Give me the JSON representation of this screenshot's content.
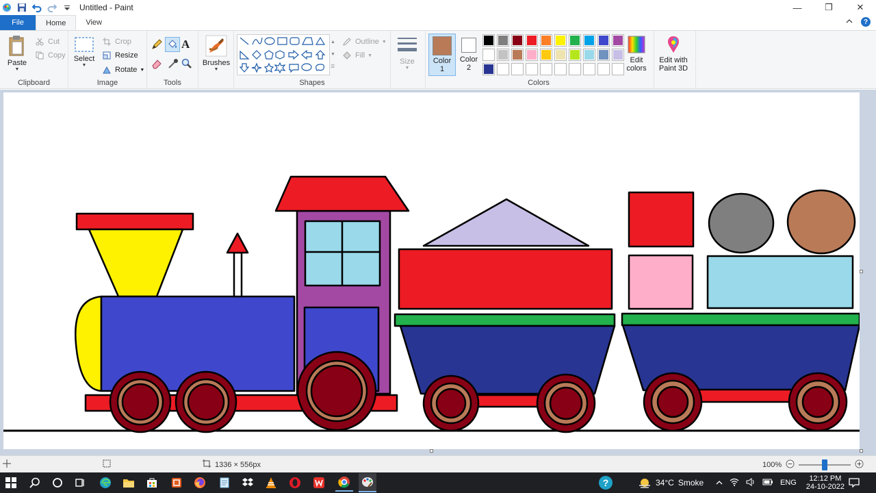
{
  "window": {
    "title": "Untitled - Paint",
    "controls": {
      "minimize": "—",
      "maximize": "❐",
      "close": "✕"
    }
  },
  "ribbon_tabs": [
    {
      "label": "File"
    },
    {
      "label": "Home"
    },
    {
      "label": "View"
    }
  ],
  "clipboard": {
    "paste_label": "Paste",
    "cut_label": "Cut",
    "copy_label": "Copy",
    "group_label": "Clipboard"
  },
  "image": {
    "select_label": "Select",
    "crop_label": "Crop",
    "resize_label": "Resize",
    "rotate_label": "Rotate",
    "group_label": "Image"
  },
  "tools": {
    "group_label": "Tools",
    "text_tool_glyph": "A"
  },
  "brushes": {
    "label": "Brushes"
  },
  "shapes": {
    "outline_label": "Outline",
    "fill_label": "Fill",
    "group_label": "Shapes"
  },
  "size": {
    "label": "Size"
  },
  "colors": {
    "color1_label": "Color",
    "color1_num": "1",
    "color2_label": "Color",
    "color2_num": "2",
    "color1_value": "#b97a57",
    "color2_value": "#ffffff",
    "edit_colors_line1": "Edit",
    "edit_colors_line2": "colors",
    "edit_3d_line1": "Edit with",
    "edit_3d_line2": "Paint 3D",
    "group_label": "Colors",
    "palette": [
      "#000000",
      "#7f7f7f",
      "#880015",
      "#ed1c24",
      "#ff7f27",
      "#fff200",
      "#22b14c",
      "#00a2e8",
      "#3f48cc",
      "#a349a4",
      "#ffffff",
      "#c3c3c3",
      "#b97a57",
      "#ffaec9",
      "#ffc90e",
      "#efe4b0",
      "#b5e61d",
      "#99d9ea",
      "#7092be",
      "#c8bfe7",
      "#283593",
      "#ffffff",
      "#ffffff",
      "#ffffff",
      "#ffffff",
      "#ffffff",
      "#ffffff",
      "#ffffff",
      "#ffffff",
      "#ffffff"
    ]
  },
  "status": {
    "dimensions": "1336 × 556px",
    "zoom": "100%",
    "zoom_fraction": 0.5
  },
  "taskbar": {
    "weather_temp": "34°C",
    "weather_text": "Smoke",
    "language": "ENG",
    "time": "12:12 PM",
    "date": "24-10-2022"
  }
}
